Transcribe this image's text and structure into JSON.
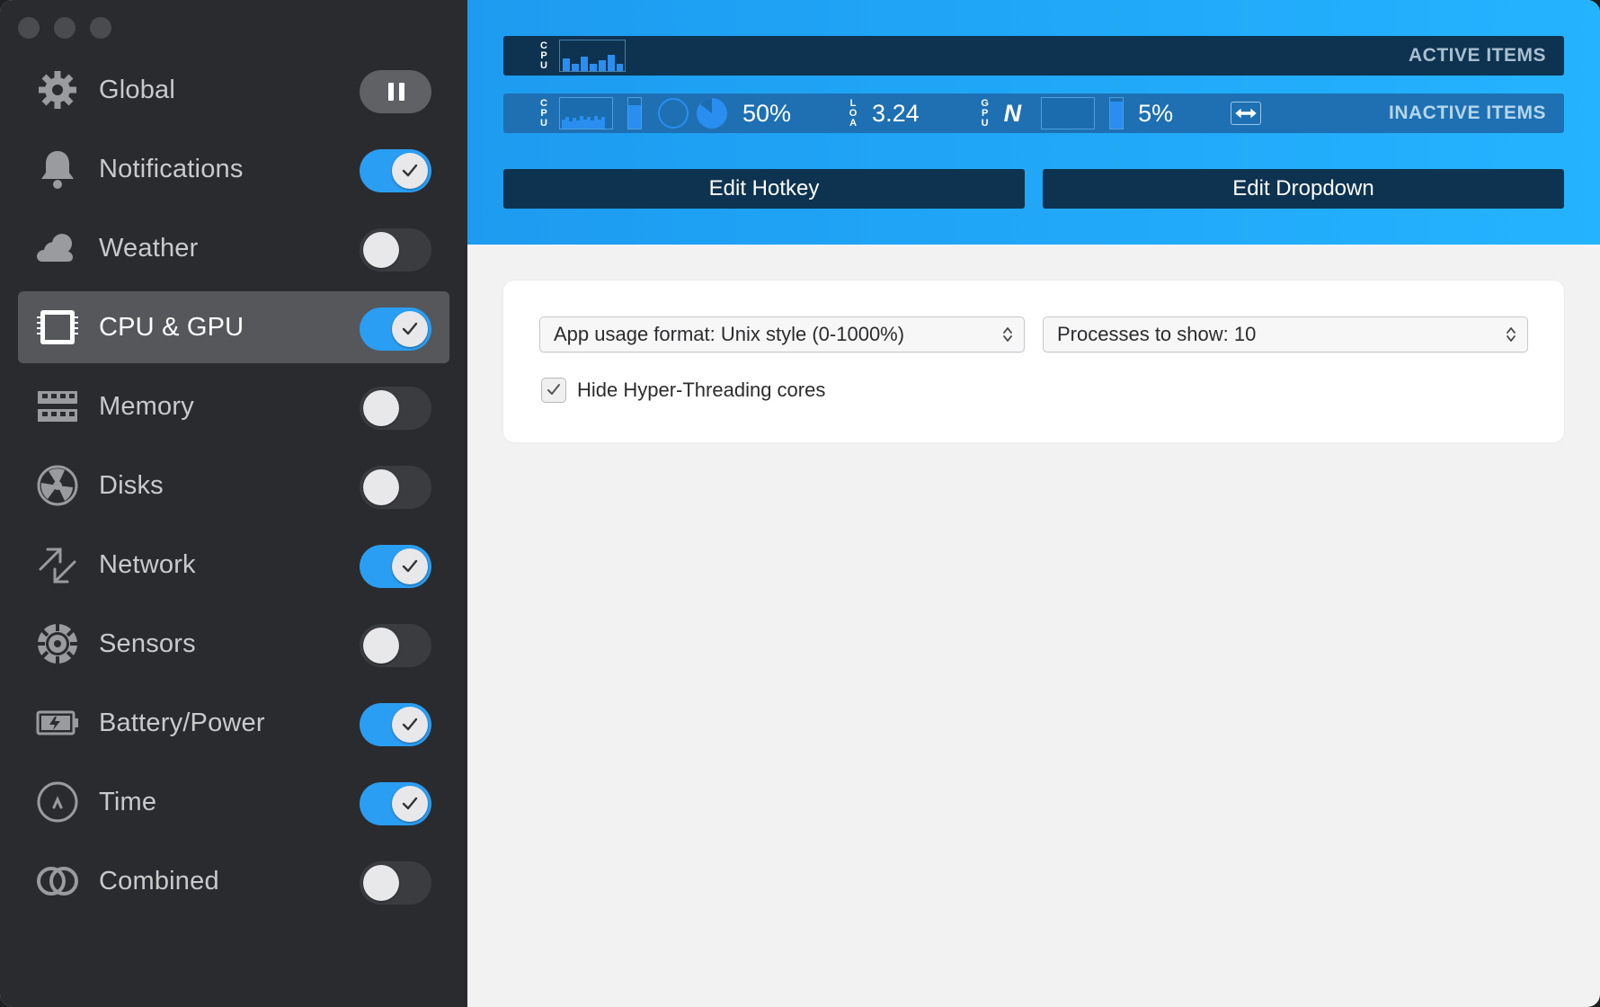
{
  "sidebar": {
    "items": [
      {
        "label": "Global",
        "icon": "gear-icon",
        "state": "pause"
      },
      {
        "label": "Notifications",
        "icon": "bell-icon",
        "state": "on"
      },
      {
        "label": "Weather",
        "icon": "cloud-icon",
        "state": "off"
      },
      {
        "label": "CPU & GPU",
        "icon": "cpu-icon",
        "state": "on",
        "selected": true
      },
      {
        "label": "Memory",
        "icon": "memory-icon",
        "state": "off"
      },
      {
        "label": "Disks",
        "icon": "disk-icon",
        "state": "off"
      },
      {
        "label": "Network",
        "icon": "network-arrows-icon",
        "state": "on"
      },
      {
        "label": "Sensors",
        "icon": "fan-icon",
        "state": "off"
      },
      {
        "label": "Battery/Power",
        "icon": "battery-icon",
        "state": "on"
      },
      {
        "label": "Time",
        "icon": "clock-icon",
        "state": "on"
      },
      {
        "label": "Combined",
        "icon": "combined-rings-icon",
        "state": "off"
      }
    ]
  },
  "header": {
    "active_items_label": "ACTIVE ITEMS",
    "inactive_items_label": "INACTIVE ITEMS",
    "cpu_label_letters": [
      "C",
      "P",
      "U"
    ],
    "load_label_letters": [
      "L",
      "O",
      "A"
    ],
    "gpu_label_letters": [
      "G",
      "P",
      "U"
    ],
    "cpu_percent": "50%",
    "load_value": "3.24",
    "gpu_vendor": "N",
    "gpu_percent": "5%",
    "edit_hotkey_label": "Edit Hotkey",
    "edit_dropdown_label": "Edit Dropdown"
  },
  "settings": {
    "app_usage_format": "App usage format: Unix style (0-1000%)",
    "processes_to_show": "Processes to show: 10",
    "hide_hyperthreading_label": "Hide Hyper-Threading cores",
    "hide_hyperthreading_checked": true
  },
  "colors": {
    "accent": "#2a9ef3",
    "sidebar_bg": "#2a2b2e",
    "header_dark": "#0d3350"
  }
}
